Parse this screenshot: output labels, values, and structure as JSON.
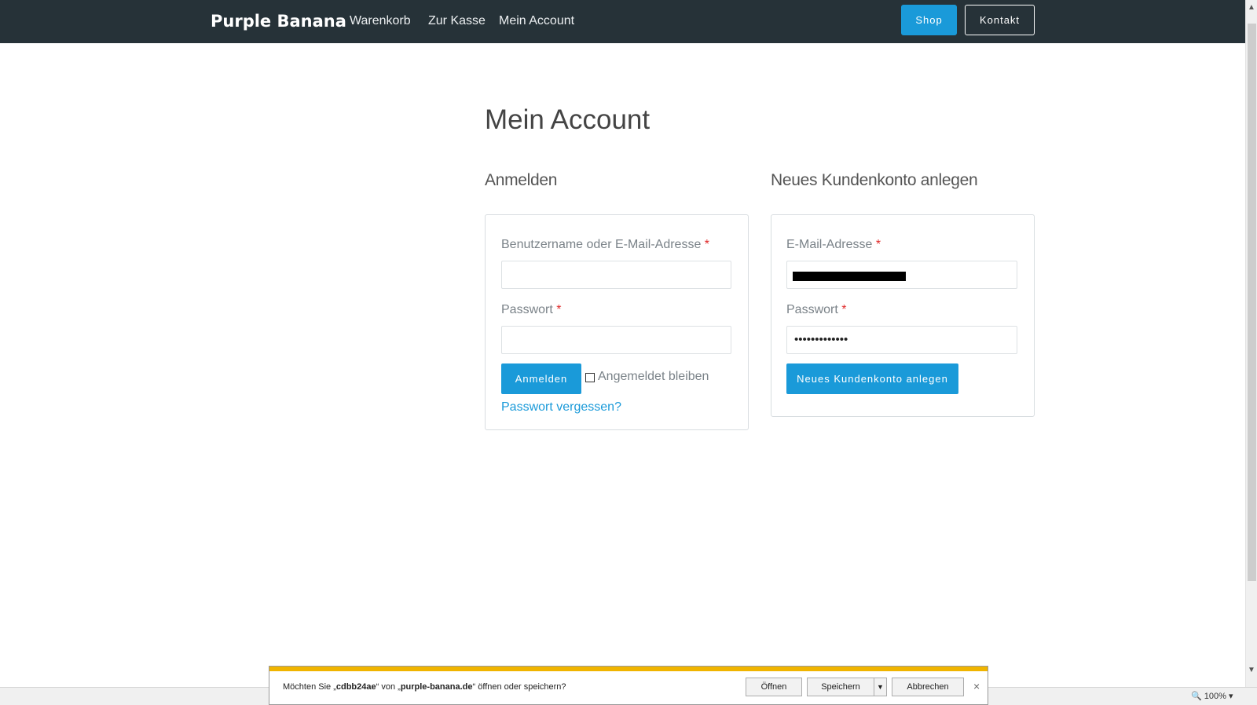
{
  "header": {
    "brand": "Purple Banana",
    "nav": [
      "Warenkorb",
      "Zur Kasse",
      "Mein Account"
    ],
    "shop_button": "Shop",
    "contact_button": "Kontakt"
  },
  "main": {
    "title": "Mein Account",
    "login": {
      "heading": "Anmelden",
      "username_label": "Benutzername oder E-Mail-Adresse",
      "password_label": "Passwort",
      "required_mark": "*",
      "submit": "Anmelden",
      "remember_label": "Angemeldet bleiben",
      "forgot_link": "Passwort vergessen?"
    },
    "register": {
      "heading": "Neues Kundenkonto anlegen",
      "email_label": "E-Mail-Adresse",
      "password_label": "Passwort",
      "required_mark": "*",
      "password_value": "•••••••••••••",
      "submit": "Neues Kundenkonto anlegen"
    }
  },
  "download_bar": {
    "prefix": "Möchten Sie „",
    "file": "cdbb24ae",
    "middle": "“ von „",
    "site": "purple-banana.de",
    "suffix": "“ öffnen oder speichern?",
    "open": "Öffnen",
    "save": "Speichern",
    "cancel": "Abbrechen"
  },
  "status": {
    "zoom": "100%"
  },
  "colors": {
    "header_bg": "#263238",
    "accent_blue": "#1a9ad9",
    "required_red": "#e02b2b",
    "download_accent": "#f0b400"
  }
}
